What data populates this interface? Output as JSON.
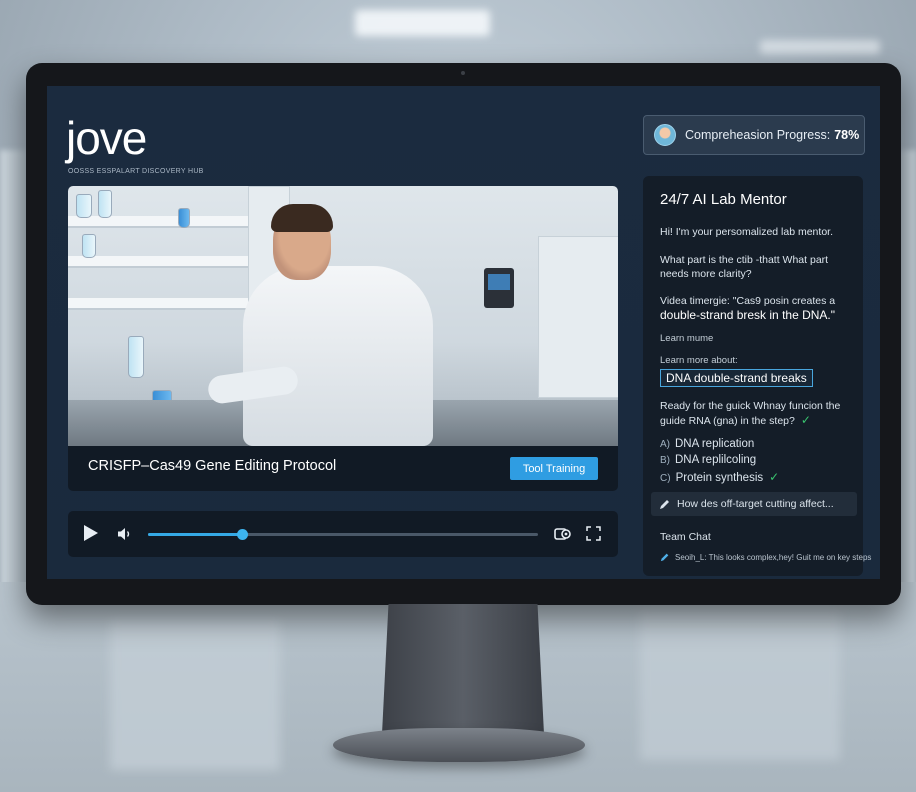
{
  "header": {
    "logo": "jove",
    "tagline": "OOSSS ESSPALART DISCOVERY HUB",
    "progress_label": "Compreheasion Progress:",
    "progress_value": "78%"
  },
  "video": {
    "title": "CRISFP–Cas49 Gene Editing Protocol",
    "tool_button": "Tool Training",
    "playback_progress": 0.24
  },
  "mentor": {
    "title": "24/7 AI Lab Mentor",
    "greeting": "Hi! I'm your persomalized lab mentor.",
    "prompt": "What part is the ctib -thatt What part needs more clarity?",
    "timestamp_line": "Videa timergie: \"Cas9 posin creates a",
    "timestamp_quote": "double-strand bresk in the DNA.\"",
    "learn_mume": "Learn mume",
    "learn_more": "Learn more about:",
    "topic": "DNA double-strand breaks",
    "quiz_question": "Ready for the guick Whnay funcion the guide RNA (gna) in the step?",
    "options": [
      {
        "letter": "A)",
        "text": "DNA replication",
        "correct": false
      },
      {
        "letter": "B)",
        "text": "DNA replilcoling",
        "correct": false
      },
      {
        "letter": "C)",
        "text": "Protein synthesis",
        "correct": true
      }
    ],
    "ask_placeholder": "How des off-target cutting affect...",
    "team_chat_label": "Team Chat",
    "team_chat_message": "Seoih_L: This looks complex,hey! Guit me on key steps"
  },
  "colors": {
    "accent": "#2f9de2",
    "check": "#39c46f",
    "panel": "#141d28",
    "screen": "#1b2b3f"
  },
  "icons": [
    "play-icon",
    "volume-icon",
    "settings-icon",
    "fullscreen-icon",
    "pencil-icon",
    "check-icon",
    "avatar"
  ]
}
